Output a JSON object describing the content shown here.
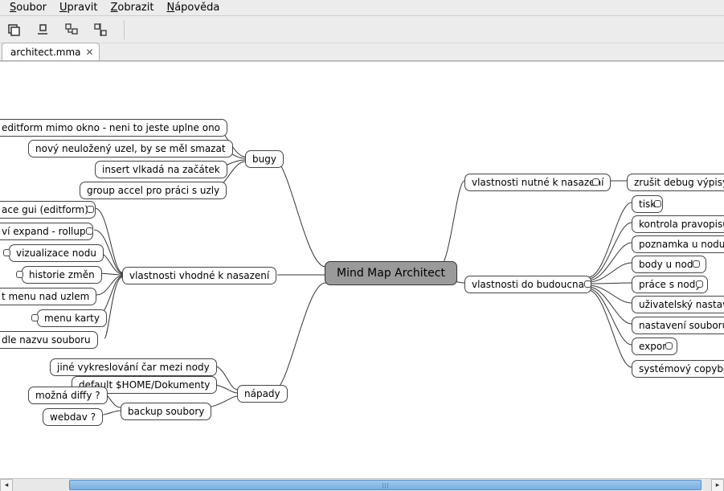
{
  "menu": {
    "file": {
      "label": "Soubor",
      "accel": "S"
    },
    "edit": {
      "label": "Upravit",
      "accel": "U"
    },
    "view": {
      "label": "Zobrazit",
      "accel": "Z"
    },
    "help": {
      "label": "Nápověda",
      "accel": "N"
    }
  },
  "tab": {
    "title": "architect.mma"
  },
  "root": {
    "label": "Mind Map Architect"
  },
  "left": {
    "bugy": {
      "label": "bugy",
      "children": [
        "editform mimo okno - neni to jeste uplne ono",
        "nový neuložený uzel, by se měl smazat",
        "insert vlkadá na začátek",
        "group accel pro práci s uzly"
      ]
    },
    "vhodne": {
      "label": "vlastnosti vhodné k nasazení",
      "children": [
        "ace gui (editform)",
        "ví expand - rollup",
        "vizualizace nodu",
        "historie změn",
        "t menu nad uzlem",
        "menu karty",
        "dle nazvu souboru"
      ]
    },
    "napady": {
      "label": "nápady",
      "children": [
        "jiné vykreslování čar mezi nody",
        "default $HOME/Dokumenty"
      ],
      "backup": {
        "label": "backup soubory",
        "children": [
          "možná diffy ?",
          "webdav ?"
        ]
      }
    }
  },
  "right": {
    "nutne": {
      "label": "vlastnosti nutné k nasazení",
      "zrusit": "zrušit debug výpisy"
    },
    "budoucna": {
      "label": "vlastnosti do budoucna",
      "children": [
        "tisk",
        "kontrola pravopisu",
        "poznamka u nodu",
        "body u nodu",
        "práce s nody",
        "uživatelský nastave",
        "nastavení souboru",
        "export",
        "systémový copybor"
      ]
    }
  }
}
